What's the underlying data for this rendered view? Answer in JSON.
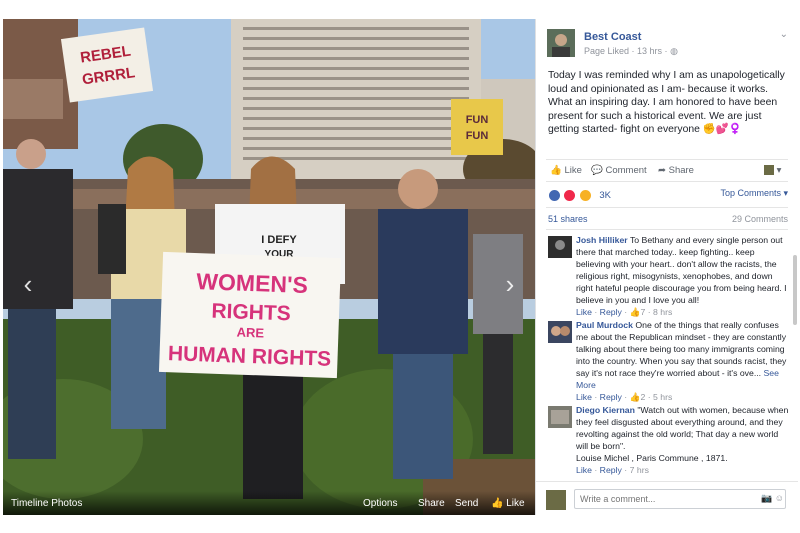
{
  "photo": {
    "sign_top": "REBEL GRRRL",
    "sign_main": "WOMEN'S RIGHTS ARE HUMAN RIGHTS",
    "shirt_text": "I DEFY YOUR",
    "sign_right": "FUN FUN",
    "bottom_bar": {
      "album": "Timeline Photos",
      "options": "Options",
      "share": "Share",
      "send": "Send",
      "like": "Like"
    }
  },
  "post": {
    "page_name": "Best Coast",
    "meta": "Page Liked · 13 hrs ·",
    "text": "Today I was reminded why I am as unapologetically loud and opinionated as I am- because it works. What an inspiring day. I am honored to have been present for such a historical event. We are just getting started- fight on everyone ✊💕♀️",
    "actions": {
      "like": "Like",
      "comment": "Comment",
      "share": "Share"
    },
    "reaction_count": "3K",
    "top_comments": "Top Comments ▾",
    "shares": "51 shares",
    "comment_count": "29 Comments"
  },
  "comments": [
    {
      "author": "Josh Hilliker",
      "text": "To Bethany and every single person out there that marched today.. keep fighting.. keep believing with your heart.. don't allow the racists, the religious right, misogynists, xenophobes, and down right hateful people discourage you from being heard. I believe in you and I love you all!",
      "like": "Like",
      "reply": "Reply",
      "reactions": "7",
      "time": "8 hrs"
    },
    {
      "author": "Paul Murdock",
      "text": "One of the things that really confuses me about the Republican mindset - they are constantly talking about there being too many immigrants coming into the country. When you say that sounds racist, they say it's not race they're worried about - it's ove...",
      "see_more": "See More",
      "like": "Like",
      "reply": "Reply",
      "reactions": "2",
      "time": "5 hrs"
    },
    {
      "author": "Diego Kiernan",
      "text": "\"Watch out with women, because when they feel disgusted about everything around, and they revolting against the old world; That day a new world will be born\".",
      "text2": "Louise Michel , Paris Commune , 1871.",
      "like": "Like",
      "reply": "Reply",
      "time": "7 hrs"
    }
  ],
  "compose": {
    "placeholder": "Write a comment..."
  },
  "colors": {
    "link": "#365899",
    "meta": "#90949c",
    "sign_ink": "#d6337b"
  }
}
